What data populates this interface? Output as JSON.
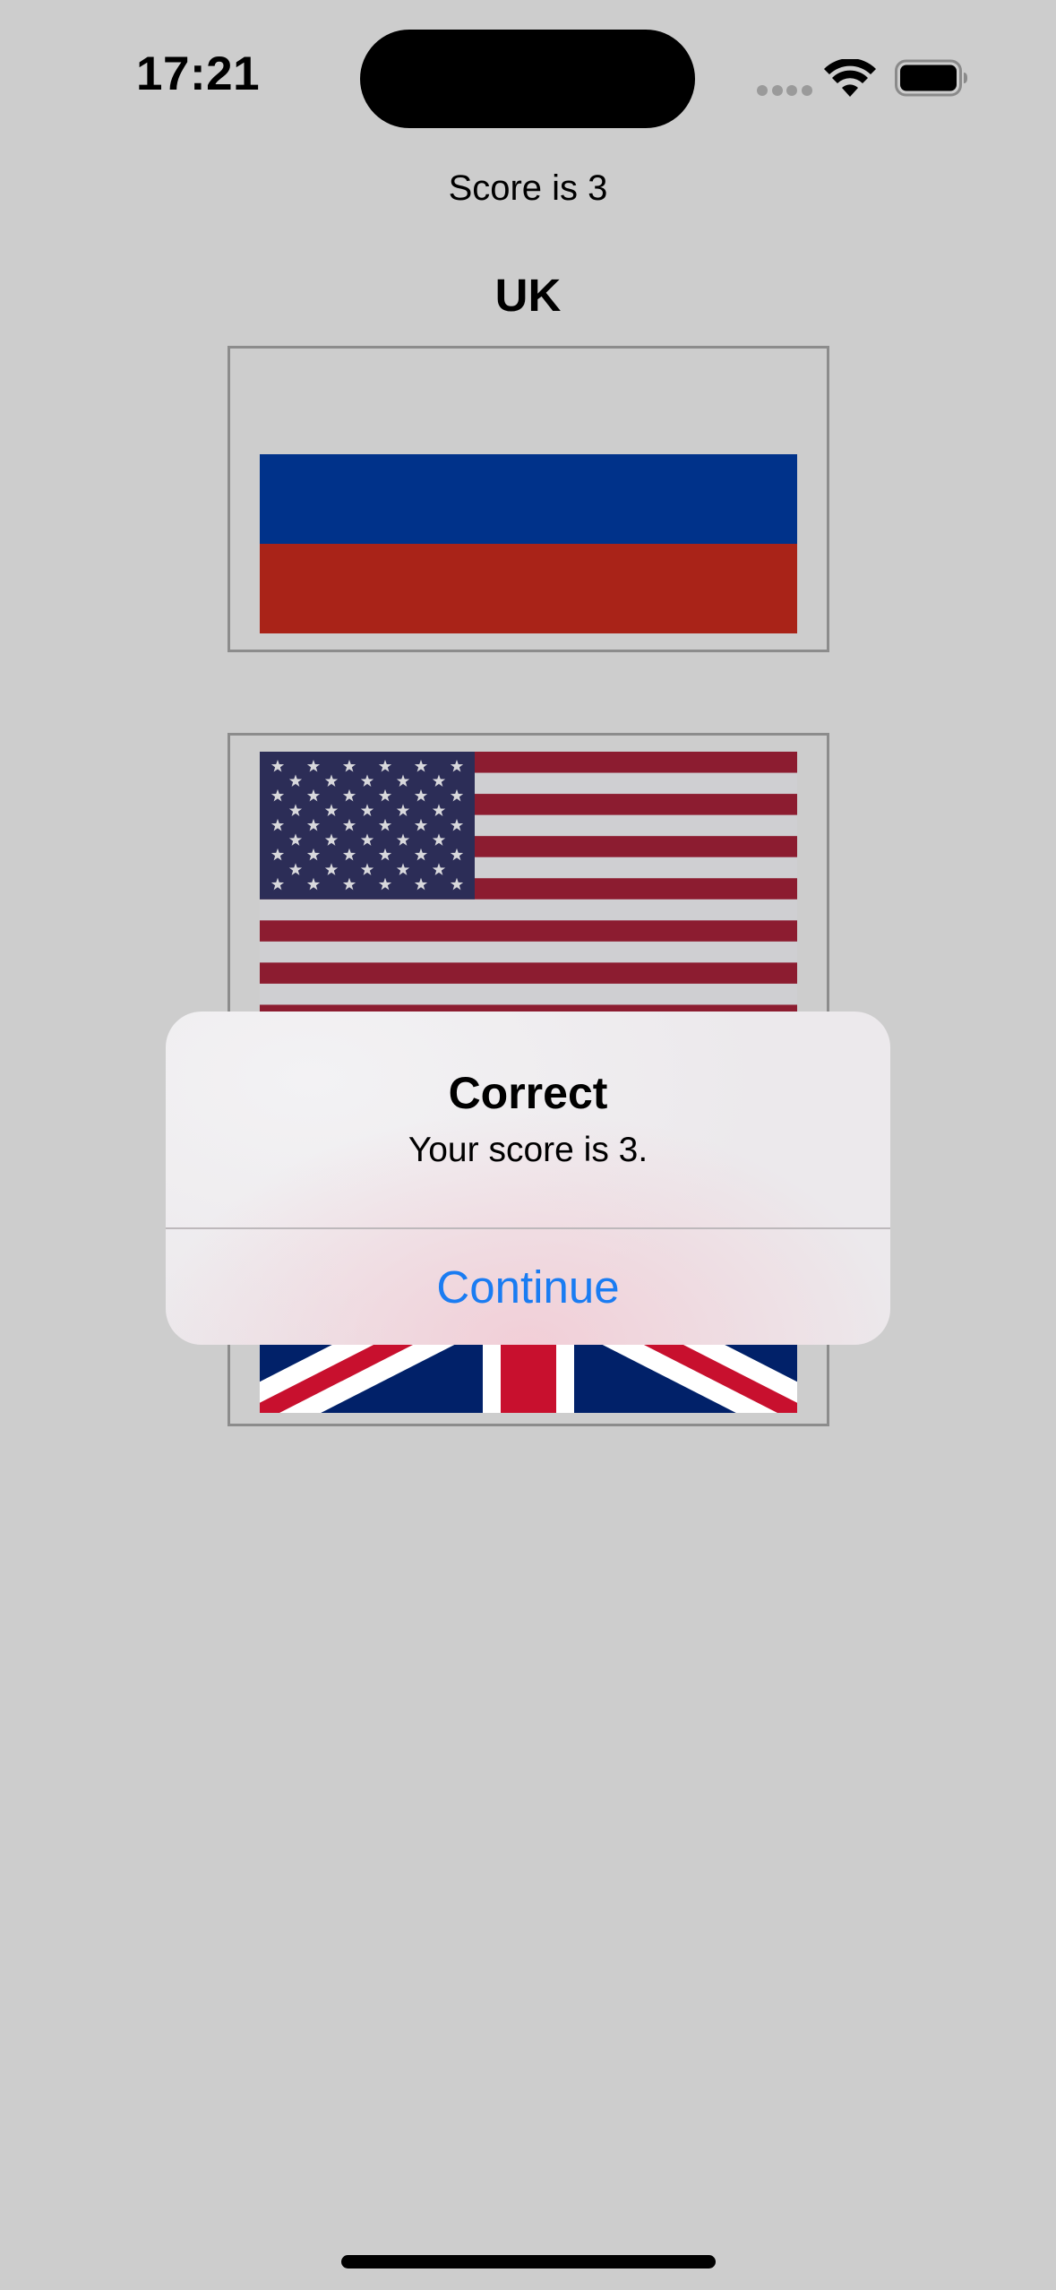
{
  "status_bar": {
    "time": "17:21",
    "icons": [
      "cellular-signal-icon",
      "wifi-icon",
      "battery-icon"
    ]
  },
  "game": {
    "score_text": "Score is 3",
    "target_country": "UK",
    "flags": [
      {
        "name": "Russia",
        "icon": "russia-flag"
      },
      {
        "name": "US",
        "icon": "us-flag"
      },
      {
        "name": "UK",
        "icon": "uk-flag"
      }
    ]
  },
  "alert": {
    "title": "Correct",
    "message": "Your score is 3.",
    "button_label": "Continue"
  },
  "colors": {
    "background": "#cdcdcd",
    "accent": "#1a7cf2",
    "russia_blue": "#00328a",
    "russia_red": "#a92318",
    "us_red": "#8c1c30",
    "us_blue": "#2c2d57",
    "uk_blue": "#012169",
    "uk_red": "#c8102e"
  }
}
